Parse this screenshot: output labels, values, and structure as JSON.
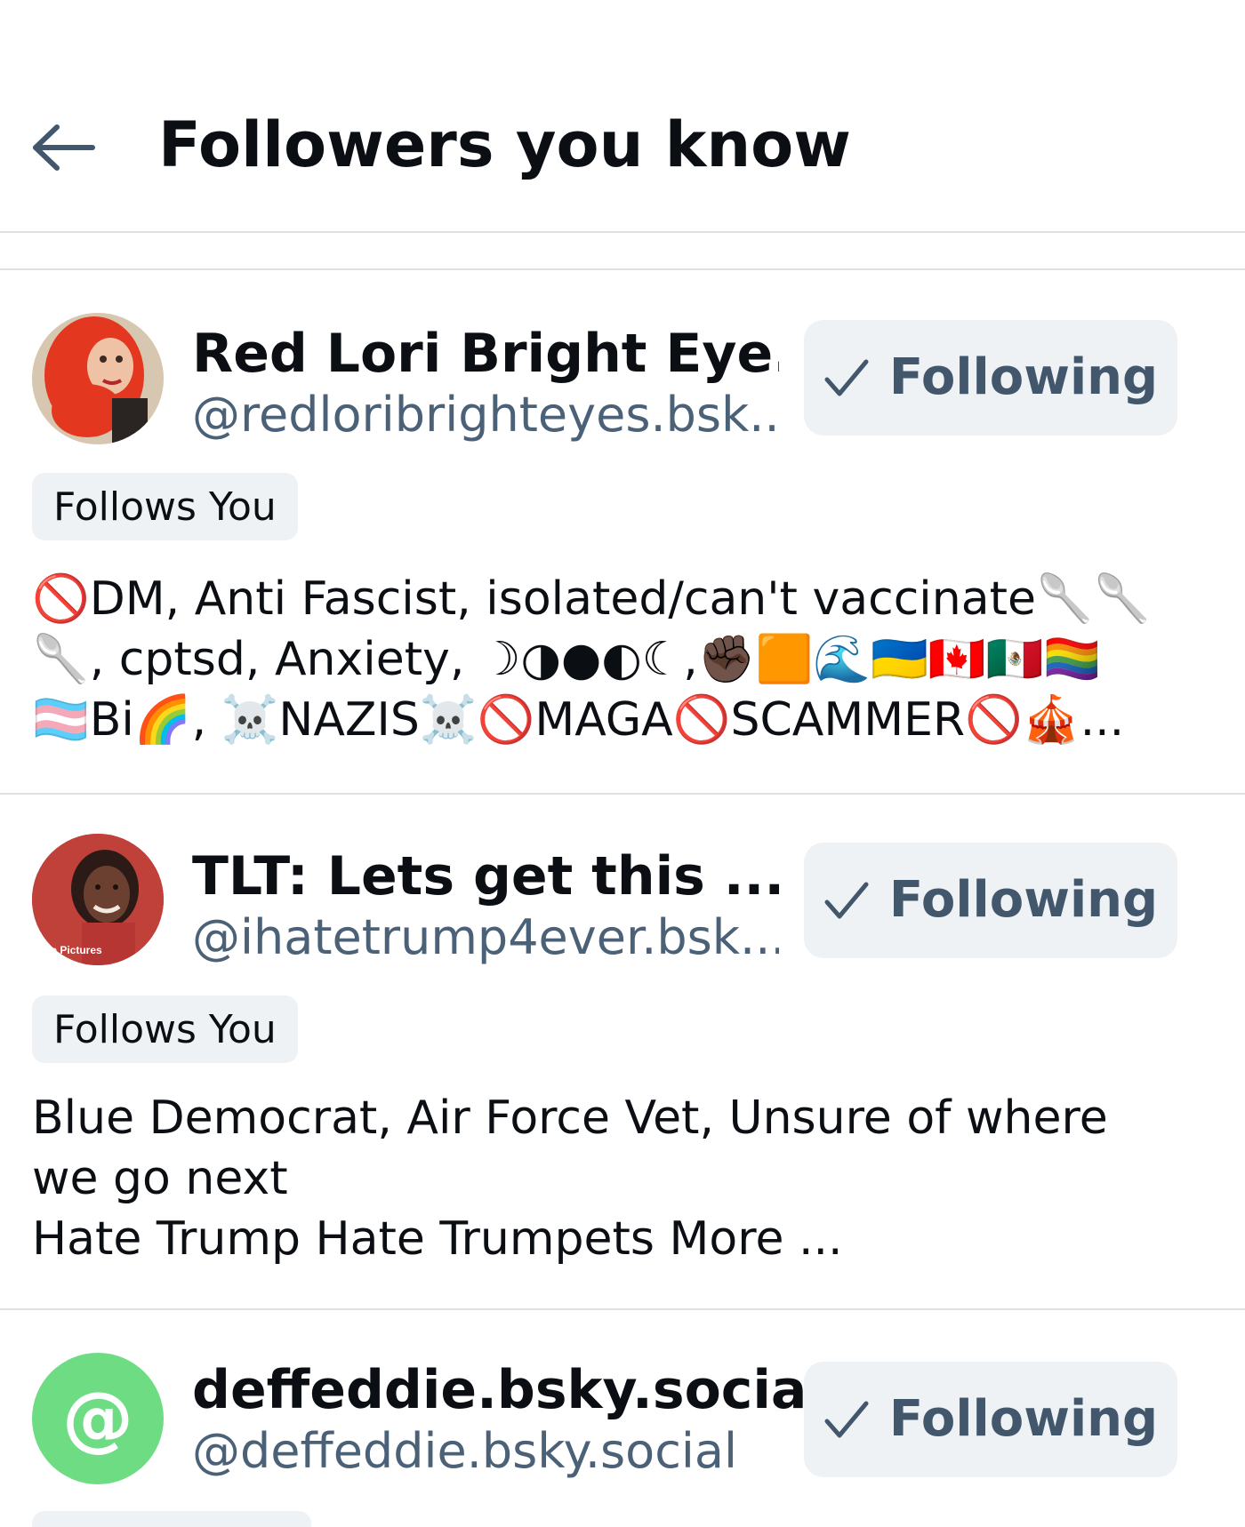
{
  "header": {
    "back_icon": "arrow-left-icon",
    "title": "Followers you know"
  },
  "followers": [
    {
      "display_name": "Red Lori Bright Eye...",
      "handle": "@redloribrighteyes.bsk...",
      "follow_label": "Following",
      "badge": "Follows You",
      "bio": "🚫DM, Anti Fascist, isolated/can't vaccinate🥄🥄\n🥄, cptsd, Anxiety, ☽◑●◐☾,✊🏿🟧🌊🇺🇦🇨🇦🇲🇽🏳️‍🌈\n🏳️‍⚧️Bi🌈, ☠️NAZIS☠️🚫MAGA🚫SCAMMER🚫🎪...",
      "avatar_icon": "profile-photo-red-hair",
      "avatar_color": "#d9482b"
    },
    {
      "display_name": "TLT: Lets get this ...",
      "handle": "@ihatetrump4ever.bsk...",
      "follow_label": "Following",
      "badge": "Follows You",
      "bio": "Blue Democrat, Air Force Vet,  Unsure of where\nwe go next\nHate Trump Hate Trumpets More ...",
      "avatar_icon": "profile-photo-woman",
      "avatar_color": "#c0413a",
      "avatar_watermark": "le Pictures"
    },
    {
      "display_name": "deffeddie.bsky.social",
      "handle": "@deffeddie.bsky.social",
      "follow_label": "Following",
      "avatar_icon": "at-sign-icon",
      "avatar_color": "#6ddc83"
    }
  ],
  "colors": {
    "accent_text": "#42576c",
    "button_bg": "#eff2f5",
    "divider": "#dde1e6",
    "handle_text": "#4b6177"
  }
}
